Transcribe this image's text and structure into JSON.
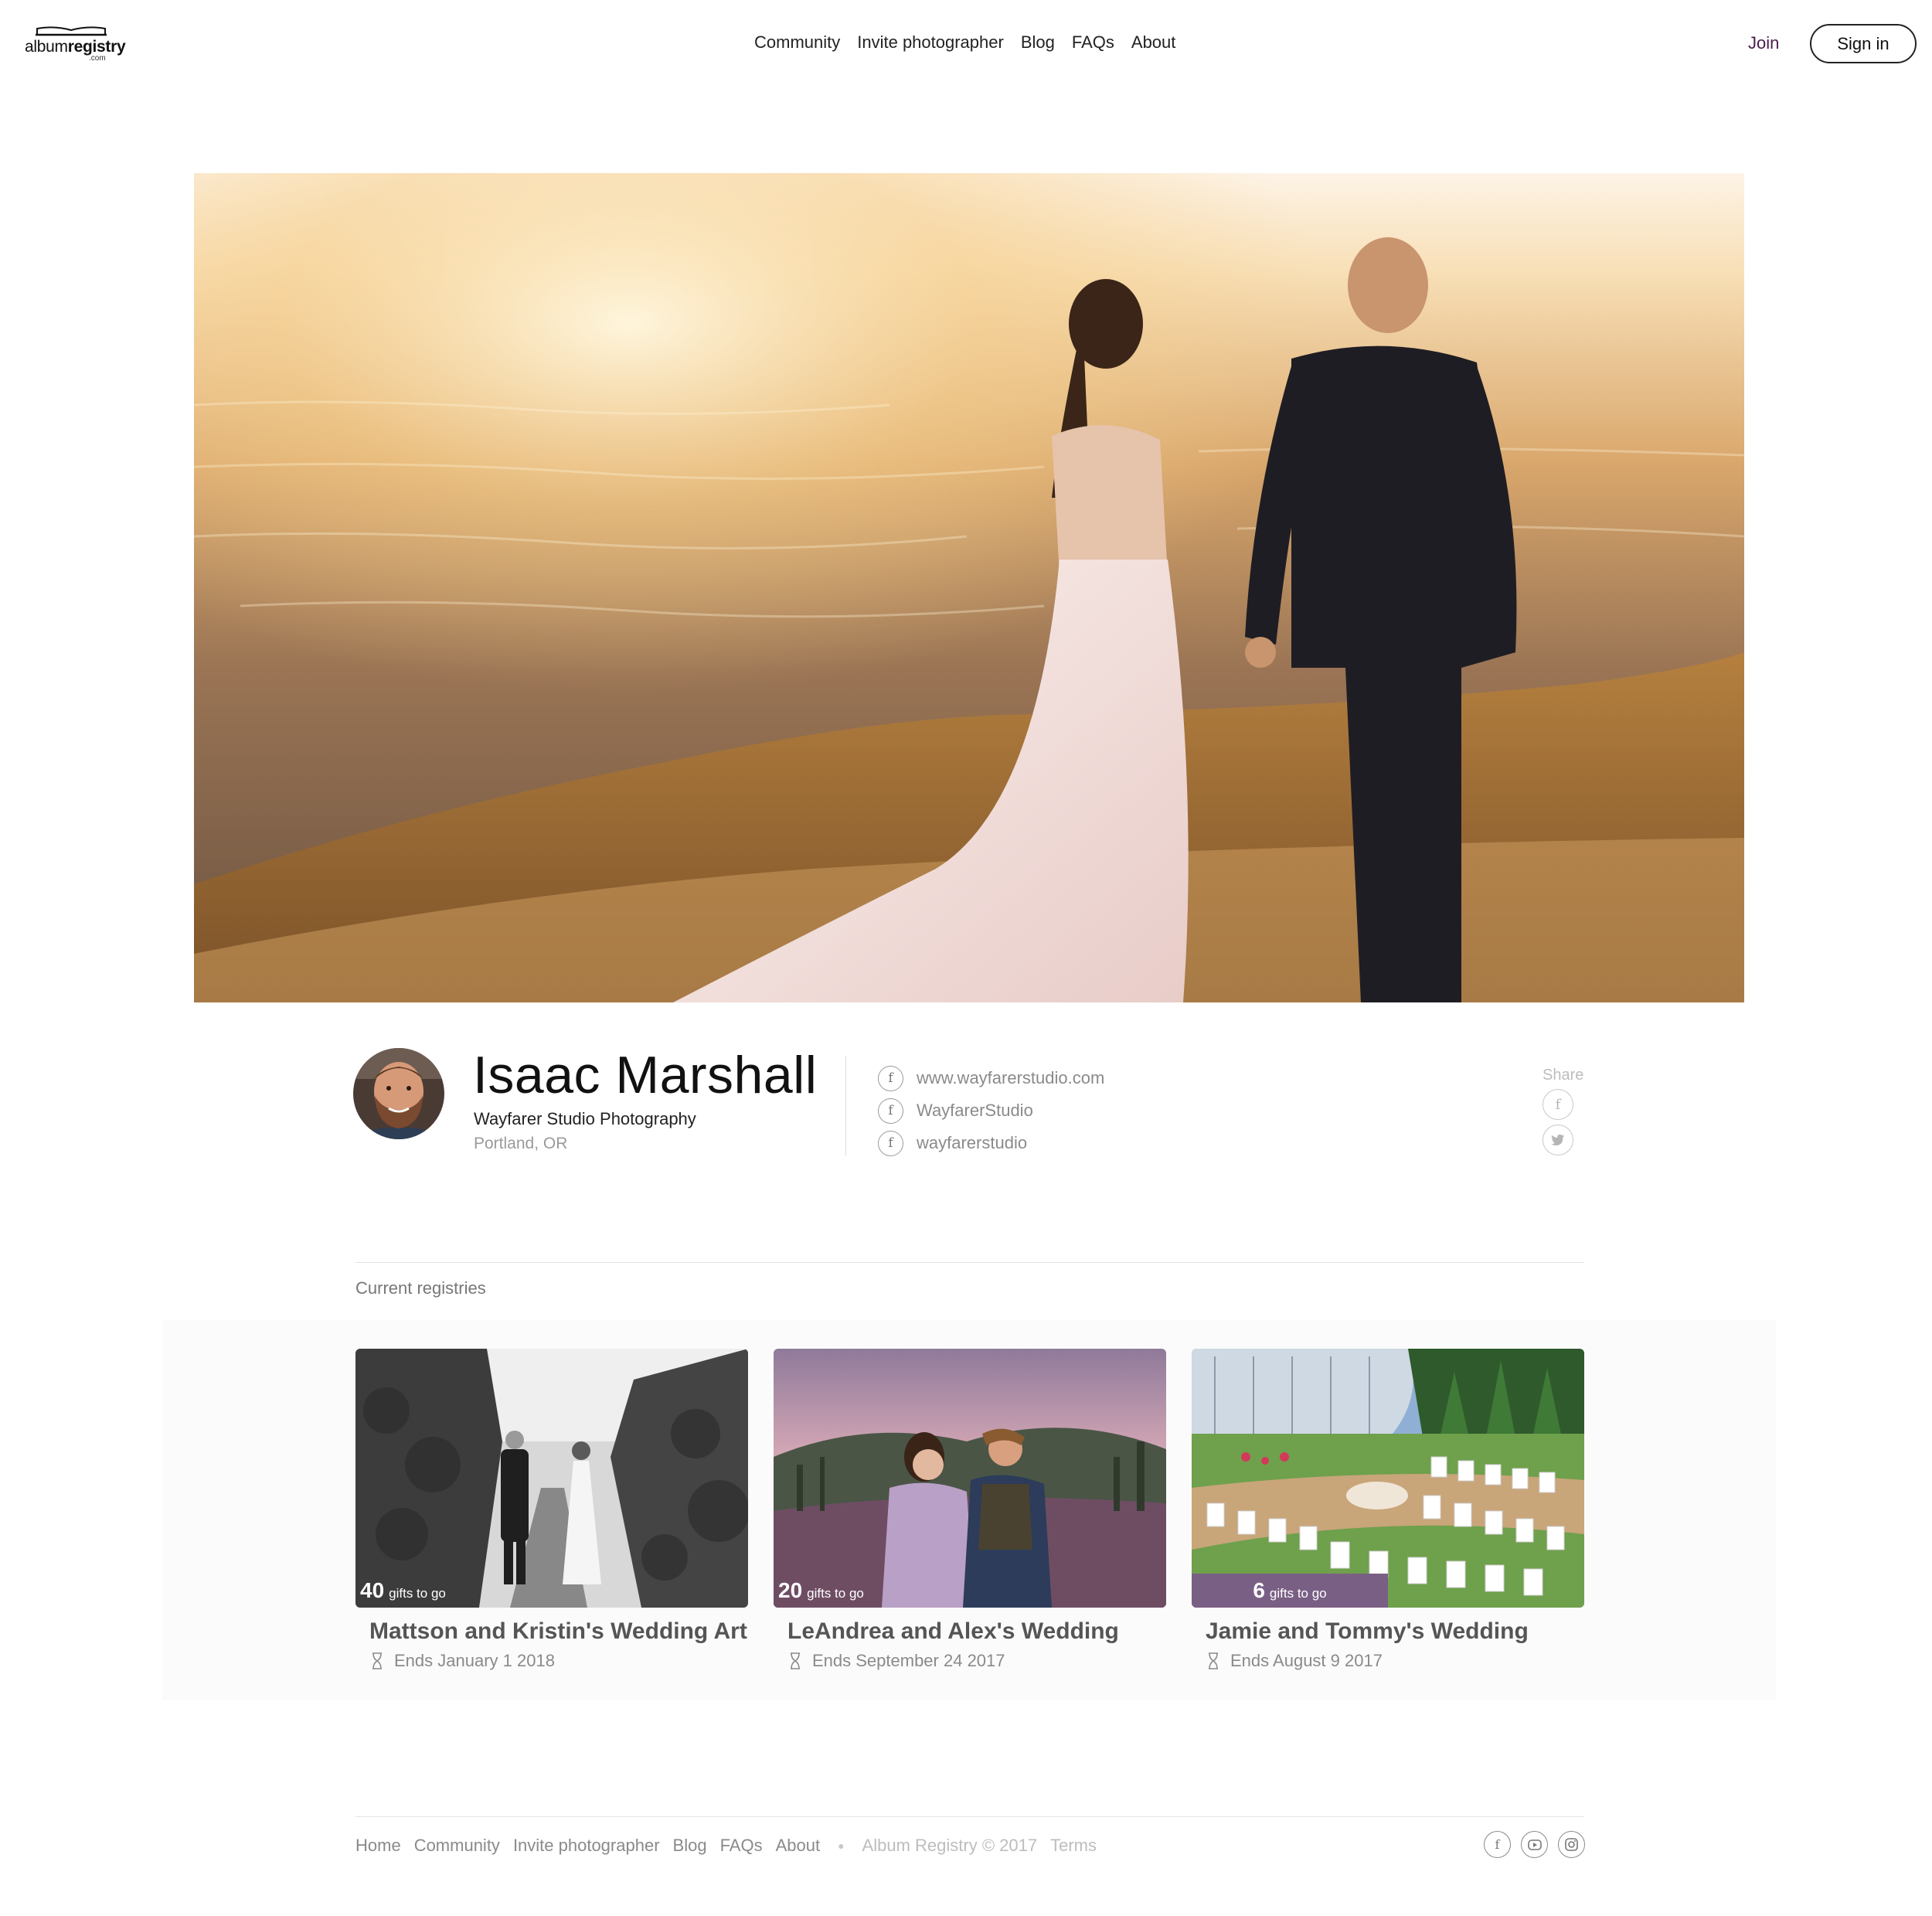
{
  "header": {
    "logo": {
      "brand_regular": "album",
      "brand_bold": "registry",
      "suffix": ".com"
    },
    "nav": [
      "Community",
      "Invite photographer",
      "Blog",
      "FAQs",
      "About"
    ],
    "join_label": "Join",
    "signin_label": "Sign in"
  },
  "profile": {
    "name": "Isaac Marshall",
    "studio": "Wayfarer Studio Photography",
    "location": "Portland, OR",
    "links": [
      {
        "icon": "facebook-icon",
        "text": "www.wayfarerstudio.com"
      },
      {
        "icon": "facebook-icon",
        "text": "WayfarerStudio"
      },
      {
        "icon": "facebook-icon",
        "text": "wayfarerstudio"
      }
    ],
    "share_label": "Share",
    "share_icons": [
      "facebook-icon",
      "twitter-icon"
    ]
  },
  "registries": {
    "heading": "Current registries",
    "cards": [
      {
        "count": "40",
        "count_label": "gifts to go",
        "title": "Mattson and Kristin's Wedding Art",
        "ends": "Ends January 1 2018"
      },
      {
        "count": "20",
        "count_label": "gifts to go",
        "title": "LeAndrea and Alex's Wedding",
        "ends": "Ends September 24 2017"
      },
      {
        "count": "6",
        "count_label": "gifts to go",
        "title": "Jamie and Tommy's Wedding",
        "ends": "Ends August 9 2017"
      }
    ]
  },
  "footer": {
    "links": [
      "Home",
      "Community",
      "Invite photographer",
      "Blog",
      "FAQs",
      "About"
    ],
    "copyright": "Album Registry © 2017",
    "terms": "Terms",
    "social_icons": [
      "facebook-icon",
      "youtube-icon",
      "instagram-icon"
    ]
  },
  "colors": {
    "accent_purple": "#4a1e4d",
    "badge_purple": "#7a5f85"
  }
}
